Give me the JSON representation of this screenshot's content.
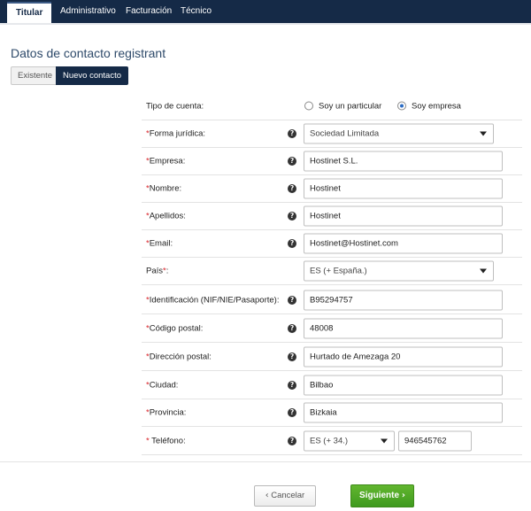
{
  "nav": {
    "tabs": [
      {
        "label": "Titular",
        "active": true
      },
      {
        "label": "Administrativo",
        "active": false
      },
      {
        "label": "Facturación",
        "active": false
      },
      {
        "label": "Técnico",
        "active": false
      }
    ]
  },
  "page": {
    "title": "Datos de contacto registrant",
    "segment": {
      "existing": "Existente",
      "new": "Nuevo contacto",
      "selected": "new"
    }
  },
  "form": {
    "account_type": {
      "label": "Tipo de cuenta:",
      "options": [
        "Soy un particular",
        "Soy empresa"
      ],
      "selected": "Soy empresa"
    },
    "forma_juridica": {
      "label": "Forma jurídica:",
      "required": "*",
      "value": "Sociedad Limitada"
    },
    "empresa": {
      "label": "Empresa:",
      "required": "*",
      "value": "Hostinet S.L."
    },
    "nombre": {
      "label": "Nombre:",
      "required": "*",
      "value": "Hostinet"
    },
    "apellidos": {
      "label": "Apellidos:",
      "required": "*",
      "value": "Hostinet"
    },
    "email": {
      "label": "Email:",
      "required": "*",
      "value": "Hostinet@Hostinet.com"
    },
    "pais": {
      "label": "País",
      "required": "*",
      "suffix": ":",
      "value": "ES (+ España.)"
    },
    "identificacion": {
      "label": "Identificación (NIF/NIE/Pasaporte):",
      "required": "*",
      "value": "B95294757"
    },
    "codigo_postal": {
      "label": "Código postal:",
      "required": "*",
      "value": "48008"
    },
    "direccion": {
      "label": "Dirección postal:",
      "required": "*",
      "value": "Hurtado de Amezaga 20"
    },
    "ciudad": {
      "label": "Ciudad:",
      "required": "*",
      "value": "Bilbao"
    },
    "provincia": {
      "label": "Provincia:",
      "required": "*",
      "value": "Bizkaia"
    },
    "telefono": {
      "label": " Teléfono:",
      "required": "*",
      "prefix_value": "ES (+ 34.)",
      "value": "946545762"
    },
    "help_glyph": "?"
  },
  "actions": {
    "cancel": "Cancelar",
    "cancel_icon": "‹",
    "next": "Siguiente",
    "next_icon": "›"
  },
  "colors": {
    "nav_bg": "#152a47",
    "required": "#d9262c",
    "primary": "#4ea628",
    "radio_selected": "#2b6cc4"
  }
}
